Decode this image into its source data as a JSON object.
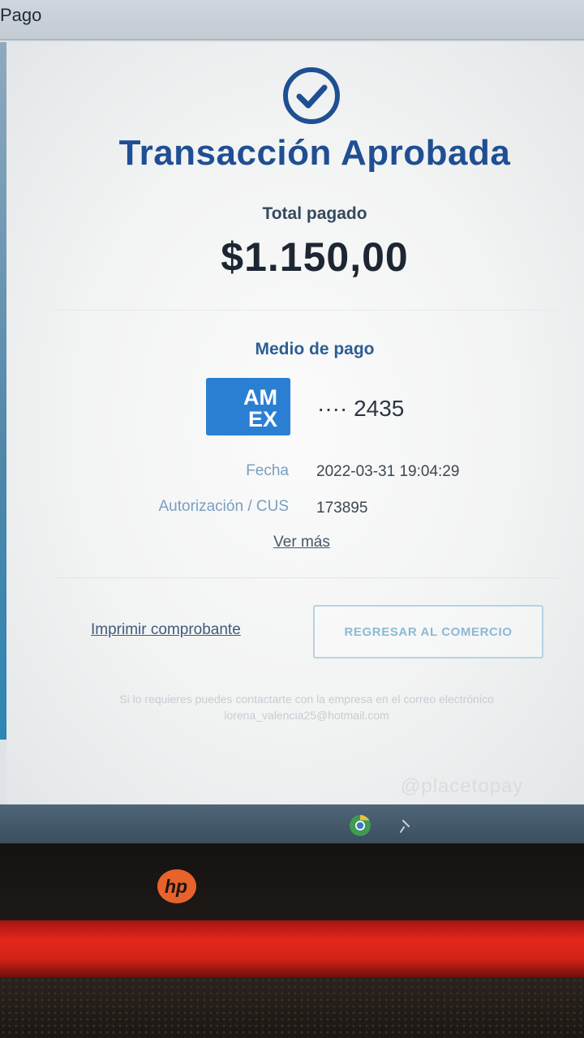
{
  "window": {
    "title": "Pago"
  },
  "receipt": {
    "status_title": "Transacción Aprobada",
    "total_label": "Total pagado",
    "total_amount": "$1.150,00",
    "payment_method_label": "Medio de pago",
    "card_brand": "AMEX",
    "card_brand_line1": "AM",
    "card_brand_line2": "EX",
    "card_number_masked": "···· 2435",
    "date_label": "Fecha",
    "date_value": "2022-03-31 19:04:29",
    "auth_label": "Autorización / CUS",
    "auth_value": "173895",
    "more_link": "Ver más",
    "print_link": "Imprimir comprobante",
    "return_button": "REGRESAR AL COMERCIO",
    "footer_note_line1": "Si lo requieres puedes contactarte con la empresa en el correo electrónico",
    "footer_note_line2": "lorena_valencia25@hotmail.com",
    "brand_mark": "placetopay"
  },
  "device": {
    "laptop_logo": "hp"
  },
  "icons": {
    "approved": "check-circle-icon",
    "card": "amex-logo-icon",
    "browser": "chrome-icon",
    "taskbar_pin": "pin-icon"
  },
  "colors": {
    "primary_blue": "#1f4f93",
    "label_blue": "#2e5d94",
    "amex_blue": "#2b7fd3",
    "button_border": "#b6d3e2",
    "laptop_red": "#e4281c"
  }
}
